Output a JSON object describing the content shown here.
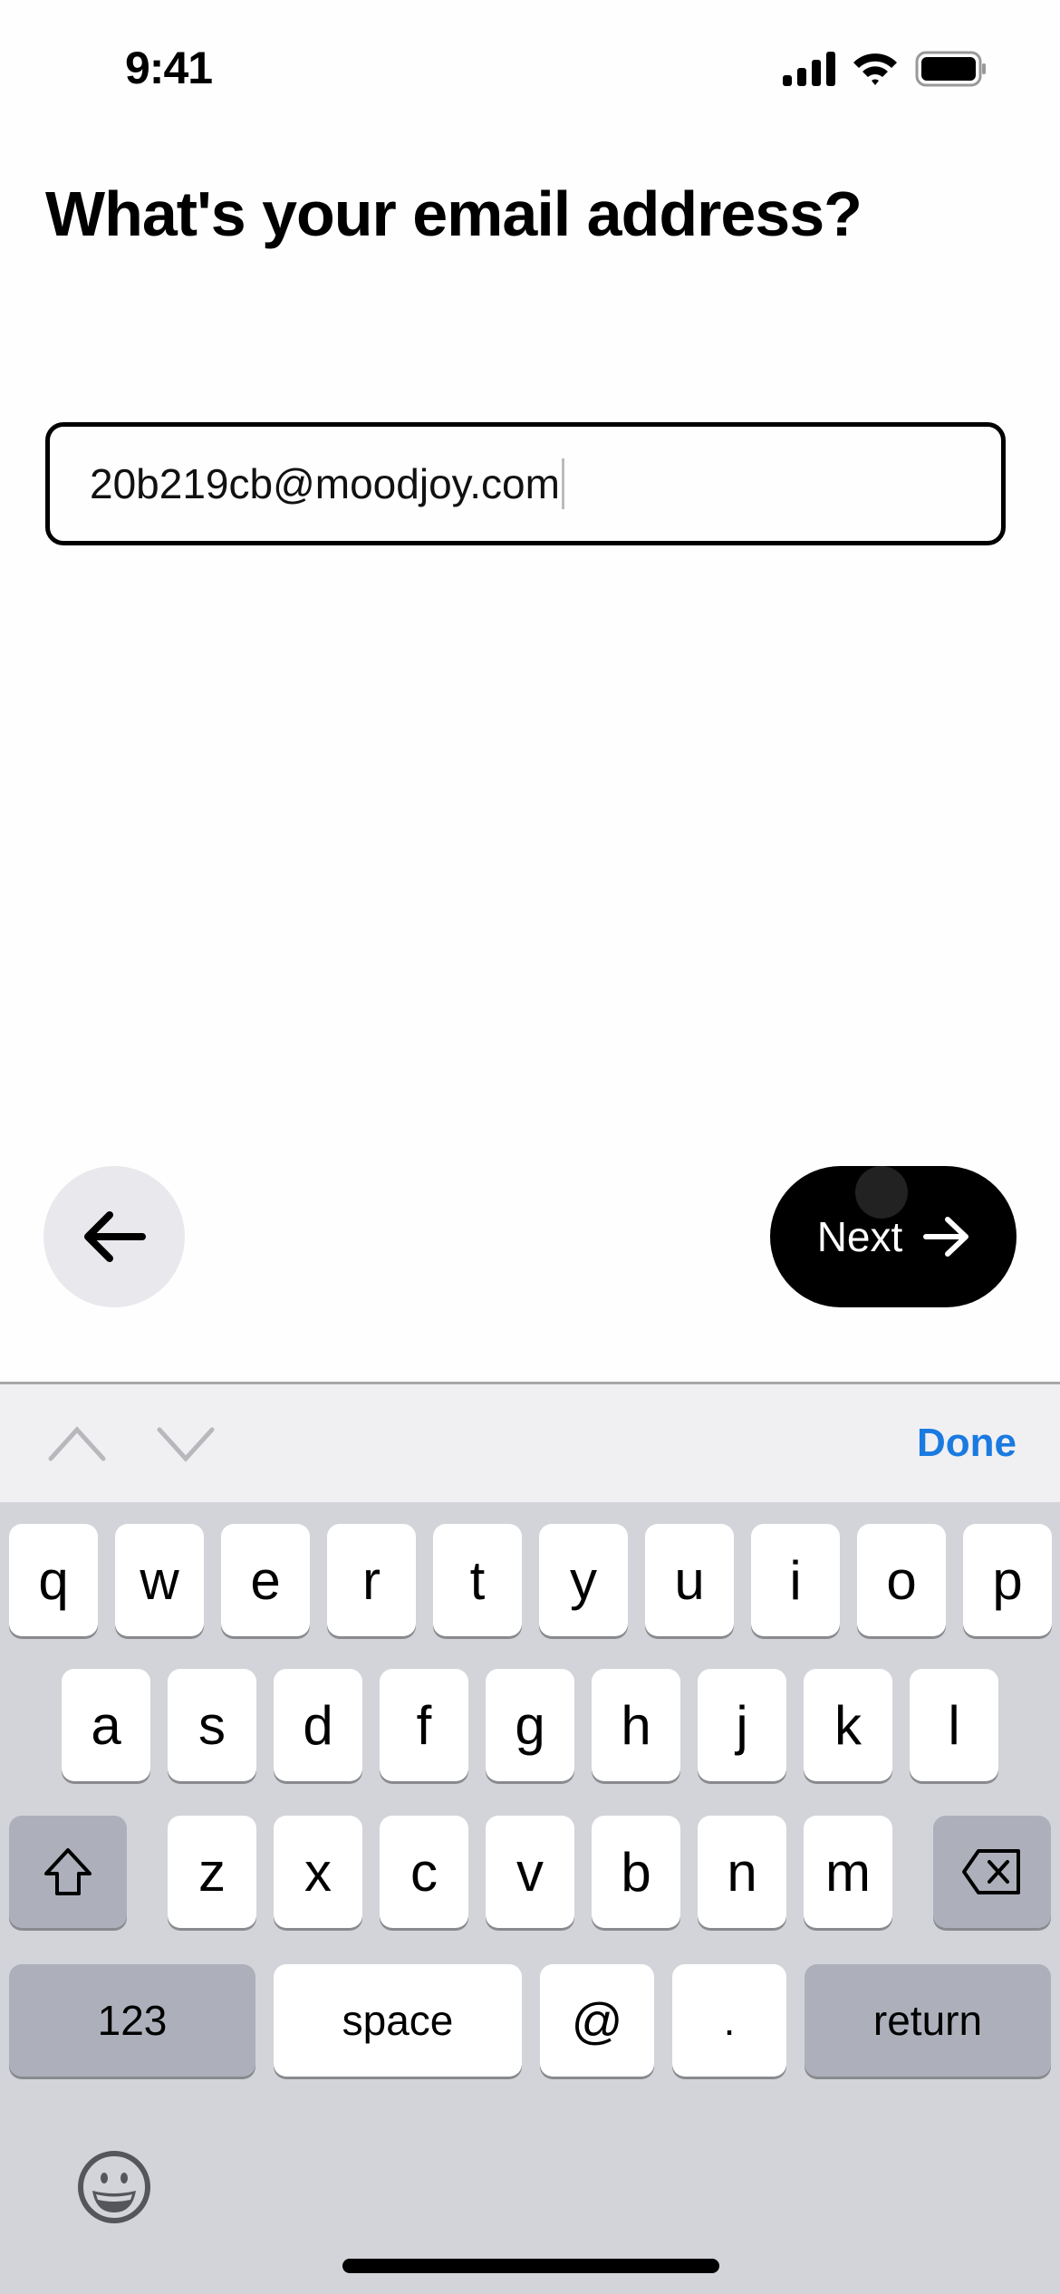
{
  "status_bar": {
    "time": "9:41",
    "icons": [
      "cellular-signal-icon",
      "wifi-icon",
      "battery-icon"
    ]
  },
  "page": {
    "title": "What's your email address?"
  },
  "email_field": {
    "value": "20b219cb@moodjoy.com",
    "focused": true
  },
  "buttons": {
    "back_icon": "arrow-left-icon",
    "next_label": "Next",
    "next_icon": "arrow-right-icon"
  },
  "accessory_bar": {
    "previous_icon": "chevron-up-icon",
    "next_icon": "chevron-down-icon",
    "done_label": "Done",
    "done_color": "#1a7ae0"
  },
  "keyboard": {
    "row1": [
      "q",
      "w",
      "e",
      "r",
      "t",
      "y",
      "u",
      "i",
      "o",
      "p"
    ],
    "row2": [
      "a",
      "s",
      "d",
      "f",
      "g",
      "h",
      "j",
      "k",
      "l"
    ],
    "row3": [
      "z",
      "x",
      "c",
      "v",
      "b",
      "n",
      "m"
    ],
    "shift_icon": "shift-icon",
    "delete_icon": "delete-backward-icon",
    "numbers_label": "123",
    "space_label": "space",
    "at_label": "@",
    "dot_label": ".",
    "return_label": "return",
    "emoji_icon": "emoji-icon"
  }
}
